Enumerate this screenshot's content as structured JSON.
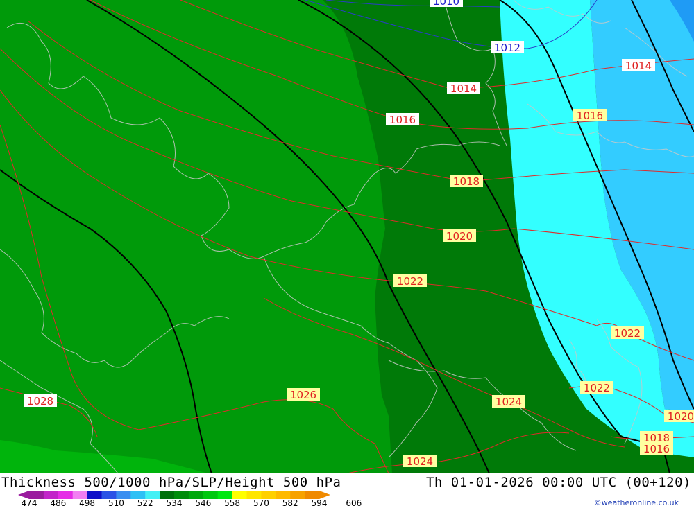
{
  "title": "Thickness 500/1000 hPa/SLP/Height 500 hPa",
  "datetime": "Th 01-01-2026 00:00 UTC (00+120)",
  "credit": "©weatheronline.co.uk",
  "colorbar": {
    "ticks": [
      "474",
      "486",
      "498",
      "510",
      "522",
      "534",
      "546",
      "558",
      "570",
      "582",
      "594",
      "606"
    ],
    "colors": [
      "#9a1b9e",
      "#c223c9",
      "#e52ce6",
      "#f27ff2",
      "#1010c8",
      "#2a52e6",
      "#3a8ef0",
      "#2ec0f5",
      "#44f0f5",
      "#00700a",
      "#008c0a",
      "#00a80c",
      "#00c80e",
      "#00e810",
      "#ffff00",
      "#ffe600",
      "#ffd000",
      "#ffba00",
      "#f7a200",
      "#f08a00"
    ]
  },
  "isobar_labels": [
    {
      "text": "1010",
      "color": "#1a1acc"
    },
    {
      "text": "1012",
      "color": "#1a1acc"
    },
    {
      "text": "1014",
      "color": "#e02020"
    },
    {
      "text": "1014",
      "color": "#e02020"
    },
    {
      "text": "1016",
      "color": "#e02020"
    },
    {
      "text": "1016",
      "color": "#e02020"
    },
    {
      "text": "1018",
      "color": "#e02020"
    },
    {
      "text": "1020",
      "color": "#e02020"
    },
    {
      "text": "1022",
      "color": "#e02020"
    },
    {
      "text": "1022",
      "color": "#e02020"
    },
    {
      "text": "1022",
      "color": "#e02020"
    },
    {
      "text": "1024",
      "color": "#e02020"
    },
    {
      "text": "1024",
      "color": "#e02020"
    },
    {
      "text": "1026",
      "color": "#e02020"
    },
    {
      "text": "1028",
      "color": "#e02020"
    },
    {
      "text": "1020",
      "color": "#e02020"
    },
    {
      "text": "1018",
      "color": "#e02020"
    },
    {
      "text": "1016",
      "color": "#e02020"
    }
  ]
}
